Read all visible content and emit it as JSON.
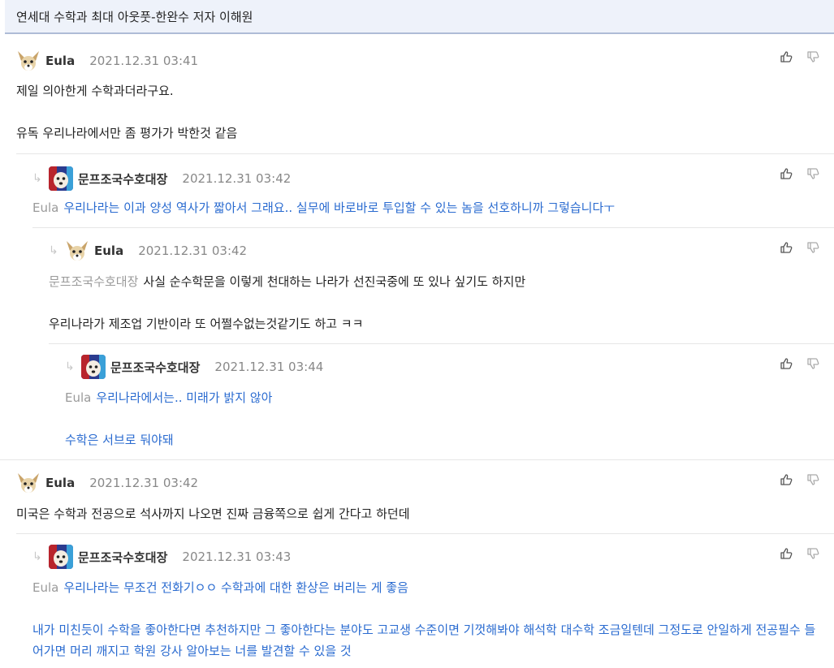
{
  "post": {
    "title": "연세대 수학과 최대 아웃풋-한완수 저자 이해원"
  },
  "comments": [
    {
      "nick": "Eula",
      "date": "2021.12.31 03:41",
      "avatar": "fox",
      "lines": [
        "제일 의아한게 수학과더라구요.",
        "유독 우리나라에서만 좀 평가가 박한것 같음"
      ]
    },
    {
      "nick": "문프조국수호대장",
      "date": "2021.12.31 03:42",
      "avatar": "dog",
      "reply_to": "Eula",
      "lines": [
        "우리나라는 이과 양성 역사가 짧아서 그래요.. 실무에 바로바로 투입할 수 있는 놈을 선호하니까 그렇습니다ㅜ"
      ]
    },
    {
      "nick": "Eula",
      "date": "2021.12.31 03:42",
      "avatar": "fox",
      "reply_to": "문프조국수호대장",
      "lines": [
        "사실 순수학문을 이렇게 천대하는 나라가 선진국중에 또 있나 싶기도 하지만",
        "우리나라가 제조업 기반이라 또 어쩔수없는것같기도 하고 ㅋㅋ"
      ]
    },
    {
      "nick": "문프조국수호대장",
      "date": "2021.12.31 03:44",
      "avatar": "dog",
      "reply_to": "Eula",
      "lines": [
        "우리나라에서는.. 미래가 밝지 않아",
        "수학은 서브로 둬야돼"
      ]
    },
    {
      "nick": "Eula",
      "date": "2021.12.31 03:42",
      "avatar": "fox",
      "lines": [
        "미국은 수학과 전공으로 석사까지 나오면 진짜 금융쪽으로 쉽게 간다고 하던데"
      ]
    },
    {
      "nick": "문프조국수호대장",
      "date": "2021.12.31 03:43",
      "avatar": "dog",
      "reply_to": "Eula",
      "lines": [
        "우리나라는 무조건 전화기ㅇㅇ 수학과에 대한 환상은 버리는 게 좋음",
        "내가 미친듯이 수학을 좋아한다면 추천하지만 그 좋아한다는 분야도 고교생 수준이면 기껏해봐야 해석학 대수학 조금일텐데 그정도로 안일하게 전공필수 들어가면 머리 깨지고 학원 강사 알아보는 너를 발견할 수 있을 것"
      ]
    }
  ]
}
